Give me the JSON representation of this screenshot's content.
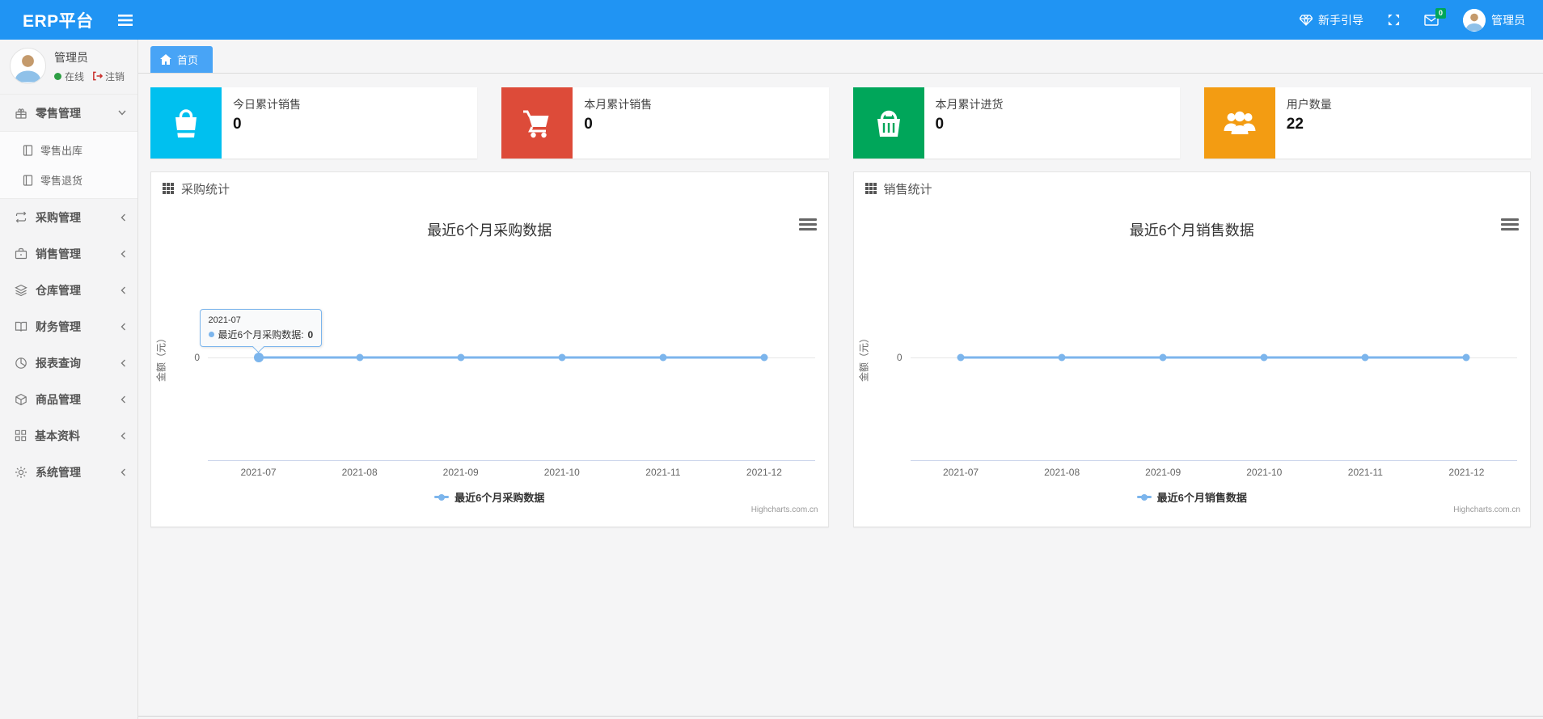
{
  "navbar": {
    "brand": "ERP平台",
    "guide_label": "新手引导",
    "messages_badge": "0",
    "username": "管理员"
  },
  "sidebar": {
    "user": {
      "name": "管理员",
      "status": "在线",
      "logout": "注销"
    },
    "menu": [
      {
        "label": "零售管理",
        "icon": "gift-icon",
        "expanded": true,
        "children": [
          "零售出库",
          "零售退货"
        ]
      },
      {
        "label": "采购管理",
        "icon": "repeat-icon"
      },
      {
        "label": "销售管理",
        "icon": "briefcase-icon"
      },
      {
        "label": "仓库管理",
        "icon": "layers-icon"
      },
      {
        "label": "财务管理",
        "icon": "book-icon"
      },
      {
        "label": "报表查询",
        "icon": "pie-chart-icon"
      },
      {
        "label": "商品管理",
        "icon": "box-icon"
      },
      {
        "label": "基本资料",
        "icon": "grid-icon"
      },
      {
        "label": "系统管理",
        "icon": "gear-icon"
      }
    ]
  },
  "tabs": [
    {
      "label": "首页",
      "active": true
    }
  ],
  "stat_cards": [
    {
      "label": "今日累计销售",
      "value": "0",
      "color": "#00c0ef",
      "icon": "shopping-bag-icon"
    },
    {
      "label": "本月累计销售",
      "value": "0",
      "color": "#dd4b39",
      "icon": "shopping-cart-icon"
    },
    {
      "label": "本月累计进货",
      "value": "0",
      "color": "#00a65a",
      "icon": "shopping-basket-icon"
    },
    {
      "label": "用户数量",
      "value": "22",
      "color": "#f39c12",
      "icon": "users-icon"
    }
  ],
  "panels": [
    {
      "title": "采购统计"
    },
    {
      "title": "销售统计"
    }
  ],
  "chart_data": [
    {
      "type": "line",
      "title": "最近6个月采购数据",
      "categories": [
        "2021-07",
        "2021-08",
        "2021-09",
        "2021-10",
        "2021-11",
        "2021-12"
      ],
      "series": [
        {
          "name": "最近6个月采购数据",
          "values": [
            0,
            0,
            0,
            0,
            0,
            0
          ],
          "color": "#7cb5ec"
        }
      ],
      "ylabel": "金额（元）",
      "yticks": [
        "0"
      ],
      "ylim": [
        0,
        1
      ],
      "grid": true,
      "legend_position": "bottom",
      "legend": "最近6个月采购数据",
      "credit": "Highcharts.com.cn",
      "tooltip": {
        "header": "2021-07",
        "label": "最近6个月采购数据:",
        "value": "0",
        "point_index": 0
      }
    },
    {
      "type": "line",
      "title": "最近6个月销售数据",
      "categories": [
        "2021-07",
        "2021-08",
        "2021-09",
        "2021-10",
        "2021-11",
        "2021-12"
      ],
      "series": [
        {
          "name": "最近6个月销售数据",
          "values": [
            0,
            0,
            0,
            0,
            0,
            0
          ],
          "color": "#7cb5ec"
        }
      ],
      "ylabel": "金额（元）",
      "yticks": [
        "0"
      ],
      "ylim": [
        0,
        1
      ],
      "grid": true,
      "legend_position": "bottom",
      "legend": "最近6个月销售数据",
      "credit": "Highcharts.com.cn"
    }
  ]
}
